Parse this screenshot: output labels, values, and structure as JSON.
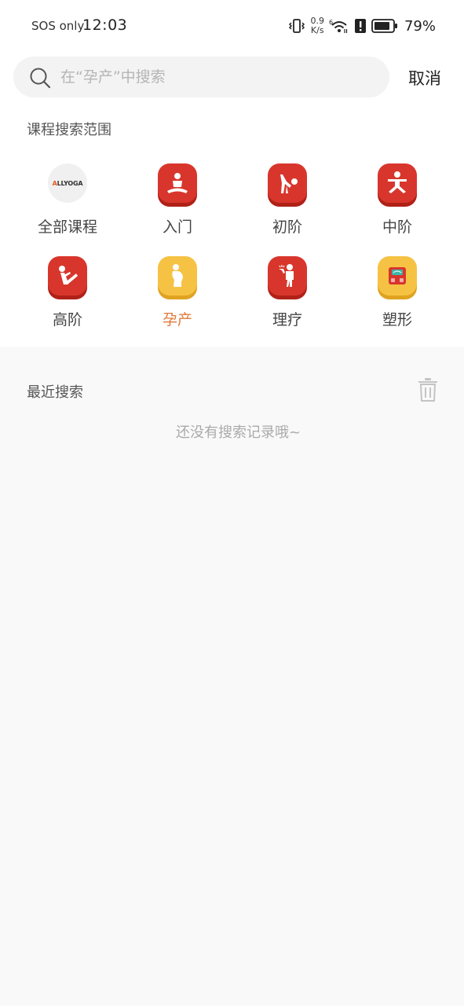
{
  "status_bar": {
    "carrier": "SOS only",
    "time": "12:03",
    "speed_value": "0.9",
    "speed_unit": "K/s",
    "wifi_badge": "6",
    "battery": "79%"
  },
  "search": {
    "placeholder": "在“孕产”中搜索",
    "value": "",
    "cancel_label": "取消"
  },
  "scope": {
    "title": "课程搜索范围",
    "logo_text_a": "A",
    "logo_text_rest": "LLYOGA",
    "categories": [
      {
        "label": "全部课程",
        "icon": "allyoga-logo-icon",
        "color": "#f0f0f0",
        "active": false
      },
      {
        "label": "入门",
        "icon": "meditation-icon",
        "color": "#d8362c",
        "active": false
      },
      {
        "label": "初阶",
        "icon": "stretch-pose-icon",
        "color": "#d8362c",
        "active": false
      },
      {
        "label": "中阶",
        "icon": "standing-pose-icon",
        "color": "#d8362c",
        "active": false
      },
      {
        "label": "高阶",
        "icon": "boat-pose-icon",
        "color": "#d8362c",
        "active": false
      },
      {
        "label": "孕产",
        "icon": "pregnant-woman-icon",
        "color": "#f6c244",
        "active": true
      },
      {
        "label": "理疗",
        "icon": "therapy-icon",
        "color": "#d8362c",
        "active": false
      },
      {
        "label": "塑形",
        "icon": "weight-scale-icon",
        "color": "#f6c244",
        "active": false
      }
    ]
  },
  "recent": {
    "title": "最近搜索",
    "empty_text": "还没有搜索记录哦~"
  },
  "colors": {
    "accent_red": "#d8362c",
    "accent_yellow": "#f6c244",
    "active_label": "#e07a3a"
  }
}
